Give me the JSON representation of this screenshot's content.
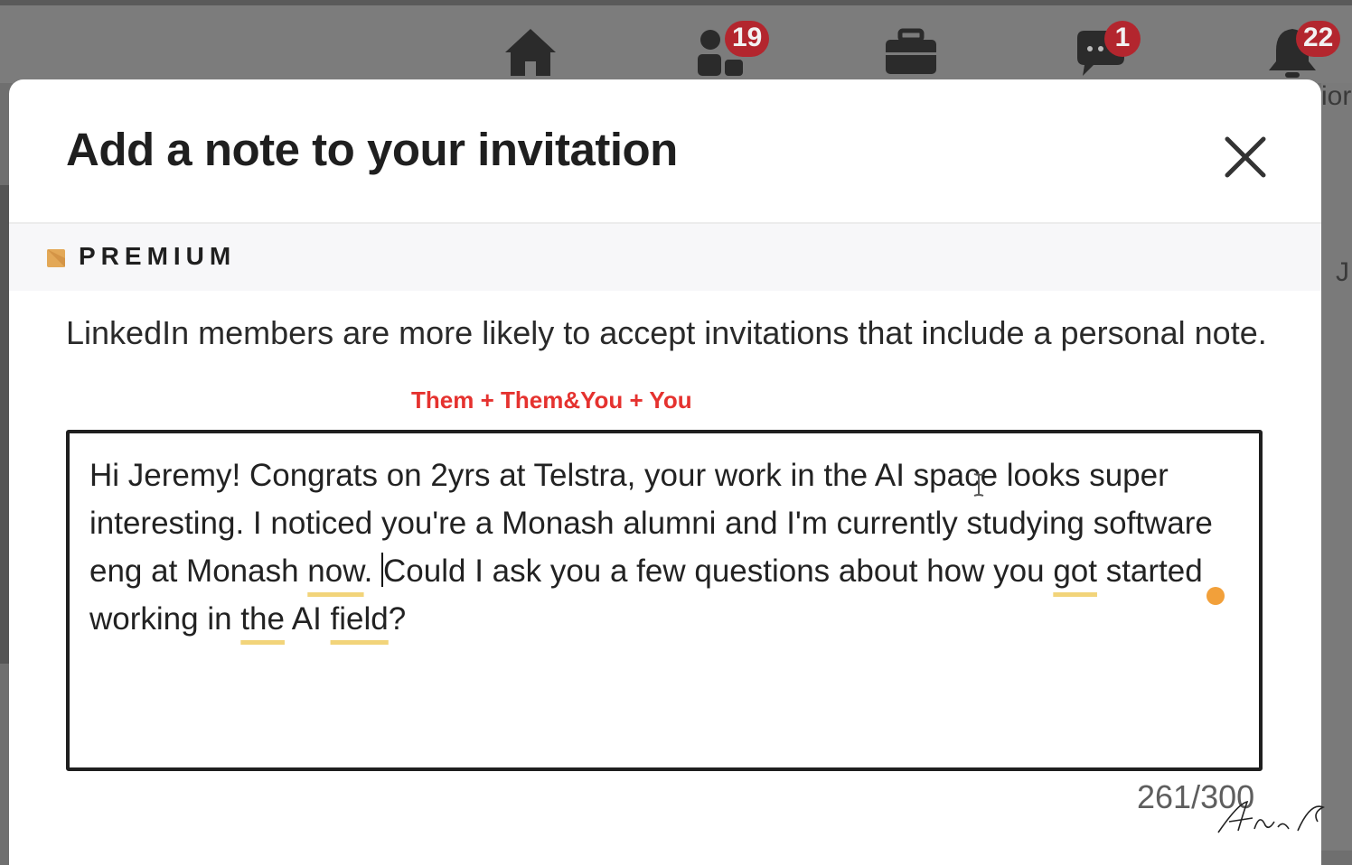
{
  "nav": {
    "home_icon": "home-icon",
    "network_badge": "19",
    "jobs_icon": "briefcase-icon",
    "messaging_badge": "1",
    "notifications_badge": "22",
    "partial_label": "ior",
    "partial_letter": "J"
  },
  "modal": {
    "title": "Add a note to your invitation",
    "close_icon": "close-icon",
    "premium_label": "PREMIUM",
    "description": "LinkedIn members are more likely to accept invitations that include a personal note.",
    "annotation": "Them  + Them&You + You",
    "note": {
      "before_caret": [
        "Hi Jeremy! Congrats on 2yrs at Telstra, your work in the AI space looks super interesting. I noticed you're a Monash alumni and I'm currently studying software eng at Monash ",
        "now",
        ". "
      ],
      "after_caret": [
        "Could I ask you a few questions about how you ",
        "got",
        " started working in ",
        "the",
        " AI ",
        "field",
        "?"
      ]
    },
    "counter": "261/300"
  },
  "colors": {
    "annotation": "#e5322f",
    "badge": "#b3262e",
    "premium_gold": "#e3a857",
    "grammar_dot": "#f2a03a",
    "underline": "#f2d47a"
  }
}
